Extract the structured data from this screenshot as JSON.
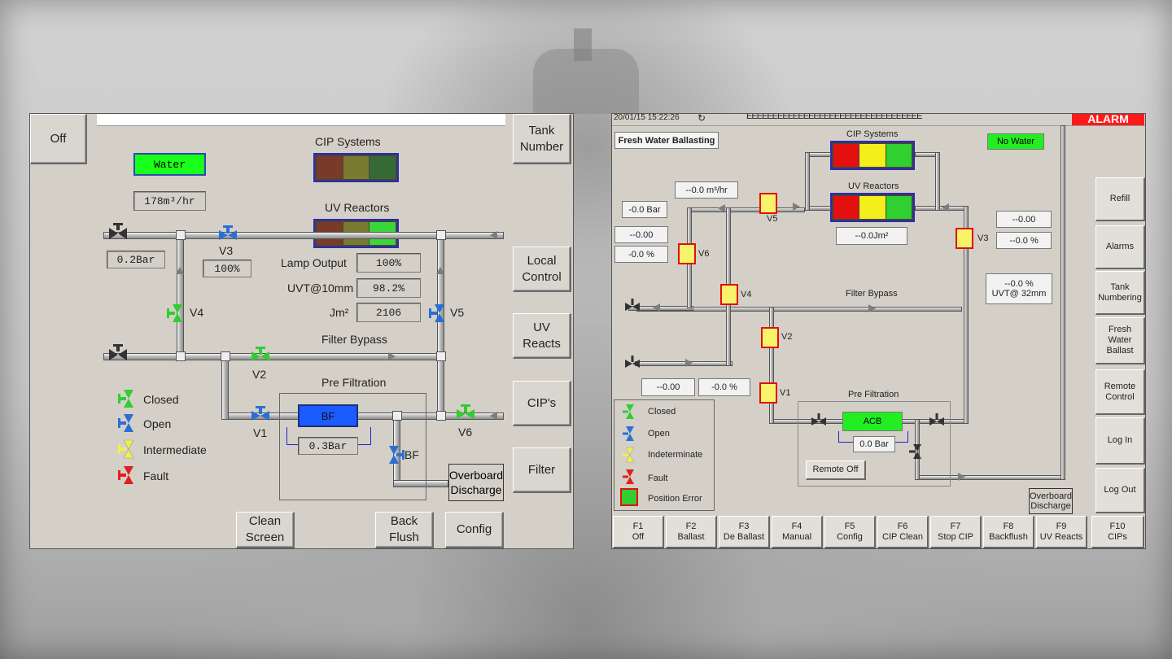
{
  "left": {
    "header_title": "",
    "buttons": {
      "off": "Off",
      "tank_number": [
        "Tank",
        "Number"
      ],
      "local_control": [
        "Local",
        "Control"
      ],
      "uv_reacts": [
        "UV",
        "Reacts"
      ],
      "cips": "CIP's",
      "filter": "Filter",
      "clean_screen": [
        "Clean",
        "Screen"
      ],
      "back_flush": [
        "Back",
        "Flush"
      ],
      "config": "Config"
    },
    "status": "Water",
    "flow": "178m³/hr",
    "pressure_in": "0.2Bar",
    "v3_pct": "100%",
    "cip_title": "CIP Systems",
    "uv_title": "UV Reactors",
    "lamp_output_label": "Lamp Output",
    "lamp_output": "100%",
    "uvt_label": "UVT@10mm",
    "uvt": "98.2%",
    "jm_label": "Jm²",
    "jm": "2106",
    "filter_bypass": "Filter Bypass",
    "pre_filtration": "Pre Filtration",
    "bf_label": "BF",
    "bf_pressure": "0.3Bar",
    "overboard": [
      "Overboard",
      "Discharge"
    ],
    "valves": {
      "v1": "V1",
      "v2": "V2",
      "v3": "V3",
      "v4": "V4",
      "v5": "V5",
      "v6": "V6",
      "bf": "BF"
    },
    "legend": [
      "Closed",
      "Open",
      "Intermediate",
      "Fault"
    ],
    "colors": {
      "closed": "#33cc33",
      "open": "#2a6fd6",
      "intermediate": "#f0ef50",
      "fault": "#e02020",
      "status_green": "#1aff1a",
      "bf_blue": "#1a5cff"
    }
  },
  "right": {
    "timestamp": "20/01/15 15:22:26",
    "header_bar": "EEEEEEEEEEEEEEEEEEEEEEEEEEEEEEEEEE",
    "alarm": "ALARM",
    "mode": "Fresh Water Ballasting",
    "status": "No Water",
    "cip_title": "CIP Systems",
    "uv_title": "UV Reactors",
    "flow": "--0.0 m³/hr",
    "pressure_in": "-0.0 Bar",
    "v6_val1": "--0.00",
    "v6_val2": "-0.0 %",
    "uv_dose": "--0.0Jm²",
    "v3_val1": "--0.00",
    "v3_val2": "--0.0 %",
    "uvt_pct": "--0.0 %",
    "uvt_label": "UVT@ 32mm",
    "filter_bypass": "Filter Bypass",
    "pre_filtration": "Pre Filtration",
    "v1_val1": "--0.00",
    "v1_val2": "-0.0 %",
    "acb_label": "ACB",
    "acb_pressure": "0.0 Bar",
    "remote_off": "Remote Off",
    "overboard": [
      "Overboard",
      "Discharge"
    ],
    "valves": {
      "v1": "V1",
      "v2": "V2",
      "v3": "V3",
      "v4": "V4",
      "v5": "V5",
      "v6": "V6"
    },
    "legend": [
      "Closed",
      "Open",
      "Indeterminate",
      "Fault",
      "Position Error"
    ],
    "side_buttons": [
      [
        "Refill"
      ],
      [
        "Alarms"
      ],
      [
        "Tank",
        "Numbering"
      ],
      [
        "Fresh",
        "Water",
        "Ballast"
      ],
      [
        "Remote",
        "Control"
      ],
      [
        "Log In"
      ],
      [
        "Log Out"
      ]
    ],
    "fkeys": [
      [
        "F1",
        "Off"
      ],
      [
        "F2",
        "Ballast"
      ],
      [
        "F3",
        "De Ballast"
      ],
      [
        "F4",
        "Manual"
      ],
      [
        "F5",
        "Config"
      ],
      [
        "F6",
        "CIP Clean"
      ],
      [
        "F7",
        "Stop CIP"
      ],
      [
        "F8",
        "Backflush"
      ],
      [
        "F9",
        "UV Reacts"
      ],
      [
        "F10",
        "CIPs"
      ]
    ],
    "colors": {
      "alarm": "#ff1a1a",
      "status_green": "#22ee22",
      "red": "#e41010",
      "yellow": "#f4ee1a",
      "green": "#30d030"
    }
  }
}
